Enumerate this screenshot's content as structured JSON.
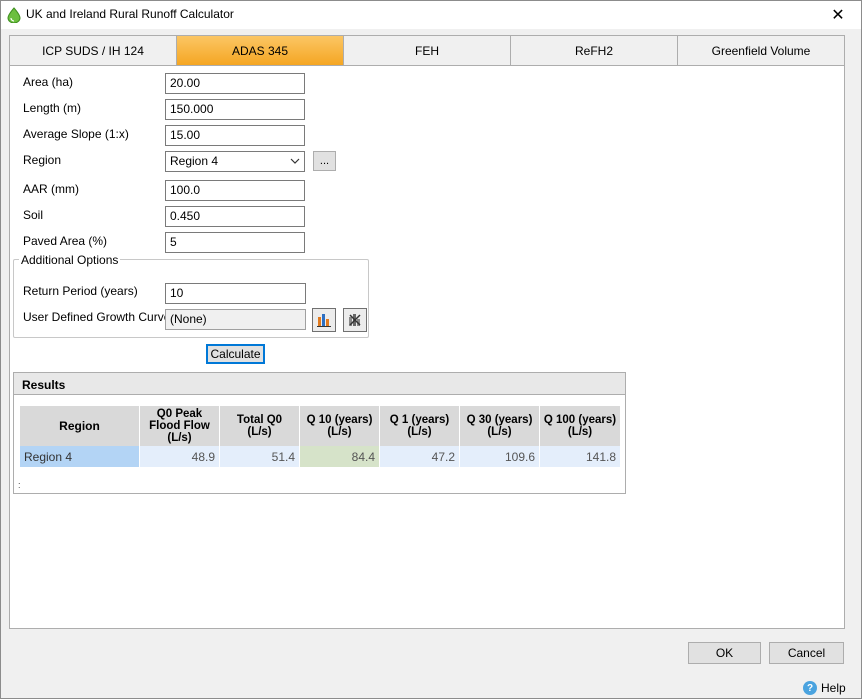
{
  "window": {
    "title": "UK and Ireland Rural Runoff Calculator",
    "close": "✕"
  },
  "tabs": [
    "ICP SUDS / IH 124",
    "ADAS 345",
    "FEH",
    "ReFH2",
    "Greenfield Volume"
  ],
  "form": {
    "area_label": "Area (ha)",
    "area_value": "20.00",
    "length_label": "Length (m)",
    "length_value": "150.000",
    "slope_label": "Average Slope (1:x)",
    "slope_value": "15.00",
    "region_label": "Region",
    "region_value": "Region 4",
    "region_browse": "...",
    "aar_label": "AAR (mm)",
    "aar_value": "100.0",
    "soil_label": "Soil",
    "soil_value": "0.450",
    "paved_label": "Paved Area (%)",
    "paved_value": "5"
  },
  "options": {
    "title": "Additional Options",
    "return_label": "Return Period (years)",
    "return_value": "10",
    "curve_label": "User Defined Growth Curve",
    "curve_value": "(None)"
  },
  "calculate_label": "Calculate",
  "results": {
    "title": "Results",
    "columns": [
      "Region",
      "Q0 Peak\nFlood Flow\n(L/s)",
      "Total Q0\n(L/s)",
      "Q 10 (years)\n(L/s)",
      "Q 1 (years)\n(L/s)",
      "Q 30 (years)\n(L/s)",
      "Q 100 (years)\n(L/s)"
    ],
    "rows": [
      [
        "Region 4",
        "48.9",
        "51.4",
        "84.4",
        "47.2",
        "109.6",
        "141.8"
      ]
    ],
    "footer": ":"
  },
  "buttons": {
    "ok": "OK",
    "cancel": "Cancel",
    "help": "Help"
  },
  "colors": {
    "active_tab": "#f5a623",
    "selected_region_cell": "#b3d4f5",
    "highlight_cell": "#d6e3c9"
  }
}
